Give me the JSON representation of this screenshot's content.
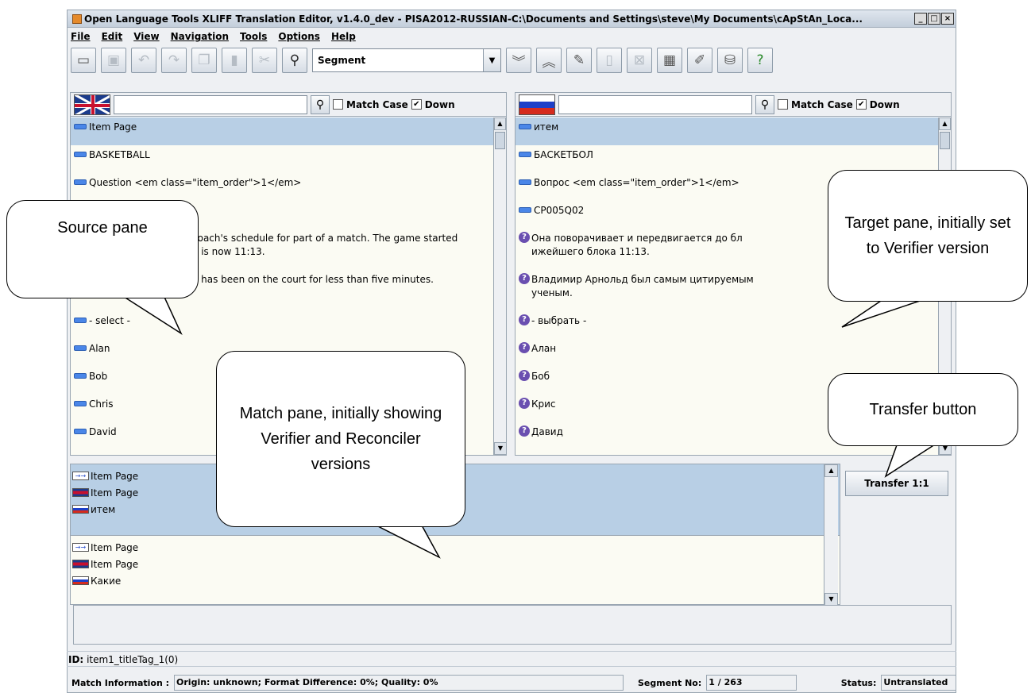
{
  "window": {
    "title": "Open Language Tools XLIFF Translation Editor, v1.4.0_dev - PISA2012-RUSSIAN-C:\\Documents and Settings\\steve\\My Documents\\cApStAn_Loca...",
    "controls": [
      "_",
      "□",
      "×"
    ]
  },
  "menu": [
    "File",
    "Edit",
    "View",
    "Navigation",
    "Tools",
    "Options",
    "Help"
  ],
  "toolbar": {
    "icons": [
      "open-icon",
      "save-icon",
      "undo-icon",
      "redo-icon",
      "copy-icon",
      "paste-icon",
      "cut-icon",
      "find-icon",
      "next-icon",
      "prev-icon",
      "edit-icon",
      "insert-icon",
      "delete-icon",
      "table-icon",
      "note-icon",
      "db-icon",
      "help-icon"
    ],
    "combo_value": "Segment"
  },
  "source_pane": {
    "match_case_label": "Match Case",
    "down_label": "Down",
    "rows": [
      "Item Page",
      "BASKETBALL",
      "Question <em class=\"item_order\">1</em>",
      "",
      "coach's schedule for part of a match. The game started",
      "e is now 11:13.",
      "o has been on the court for less than five minutes.",
      "- select -",
      "Alan",
      "Bob",
      "Chris",
      "David"
    ]
  },
  "target_pane": {
    "match_case_label": "Match Case",
    "down_label": "Down",
    "rows": [
      "итем",
      "БАСКЕТБОЛ",
      "Вопрос <em class=\"item_order\">1</em>",
      "CP005Q02",
      "Она поворачивает и передвигается до бл",
      "ижейшего блока 11:13.",
      "Владимир Арнольд был самым цитируемым",
      "ученым.",
      "- выбрать -",
      "Алан",
      "Боб",
      "Крис",
      "Давид"
    ]
  },
  "match_pane": {
    "blocks": [
      {
        "tm": "Item Page",
        "source": "Item Page",
        "target": "итем"
      },
      {
        "tm": "Item Page",
        "source": "Item Page",
        "target": "Какие"
      }
    ]
  },
  "transfer_button": "Transfer 1:1",
  "id_bar": {
    "label": "ID:",
    "value": "item1_titleTag_1(0)"
  },
  "status": {
    "match_info_label": "Match Information :",
    "match_info_value": "Origin: unknown; Format Difference: 0%; Quality: 0%",
    "segment_label": "Segment No:",
    "segment_value": " 1 / 263",
    "status_label": "Status:",
    "status_value": "Untranslated"
  },
  "callouts": {
    "source": "Source pane",
    "target": "Target pane, initially set to Verifier version",
    "match": "Match pane, initially showing Verifier and Reconciler versions",
    "transfer": "Transfer button"
  }
}
